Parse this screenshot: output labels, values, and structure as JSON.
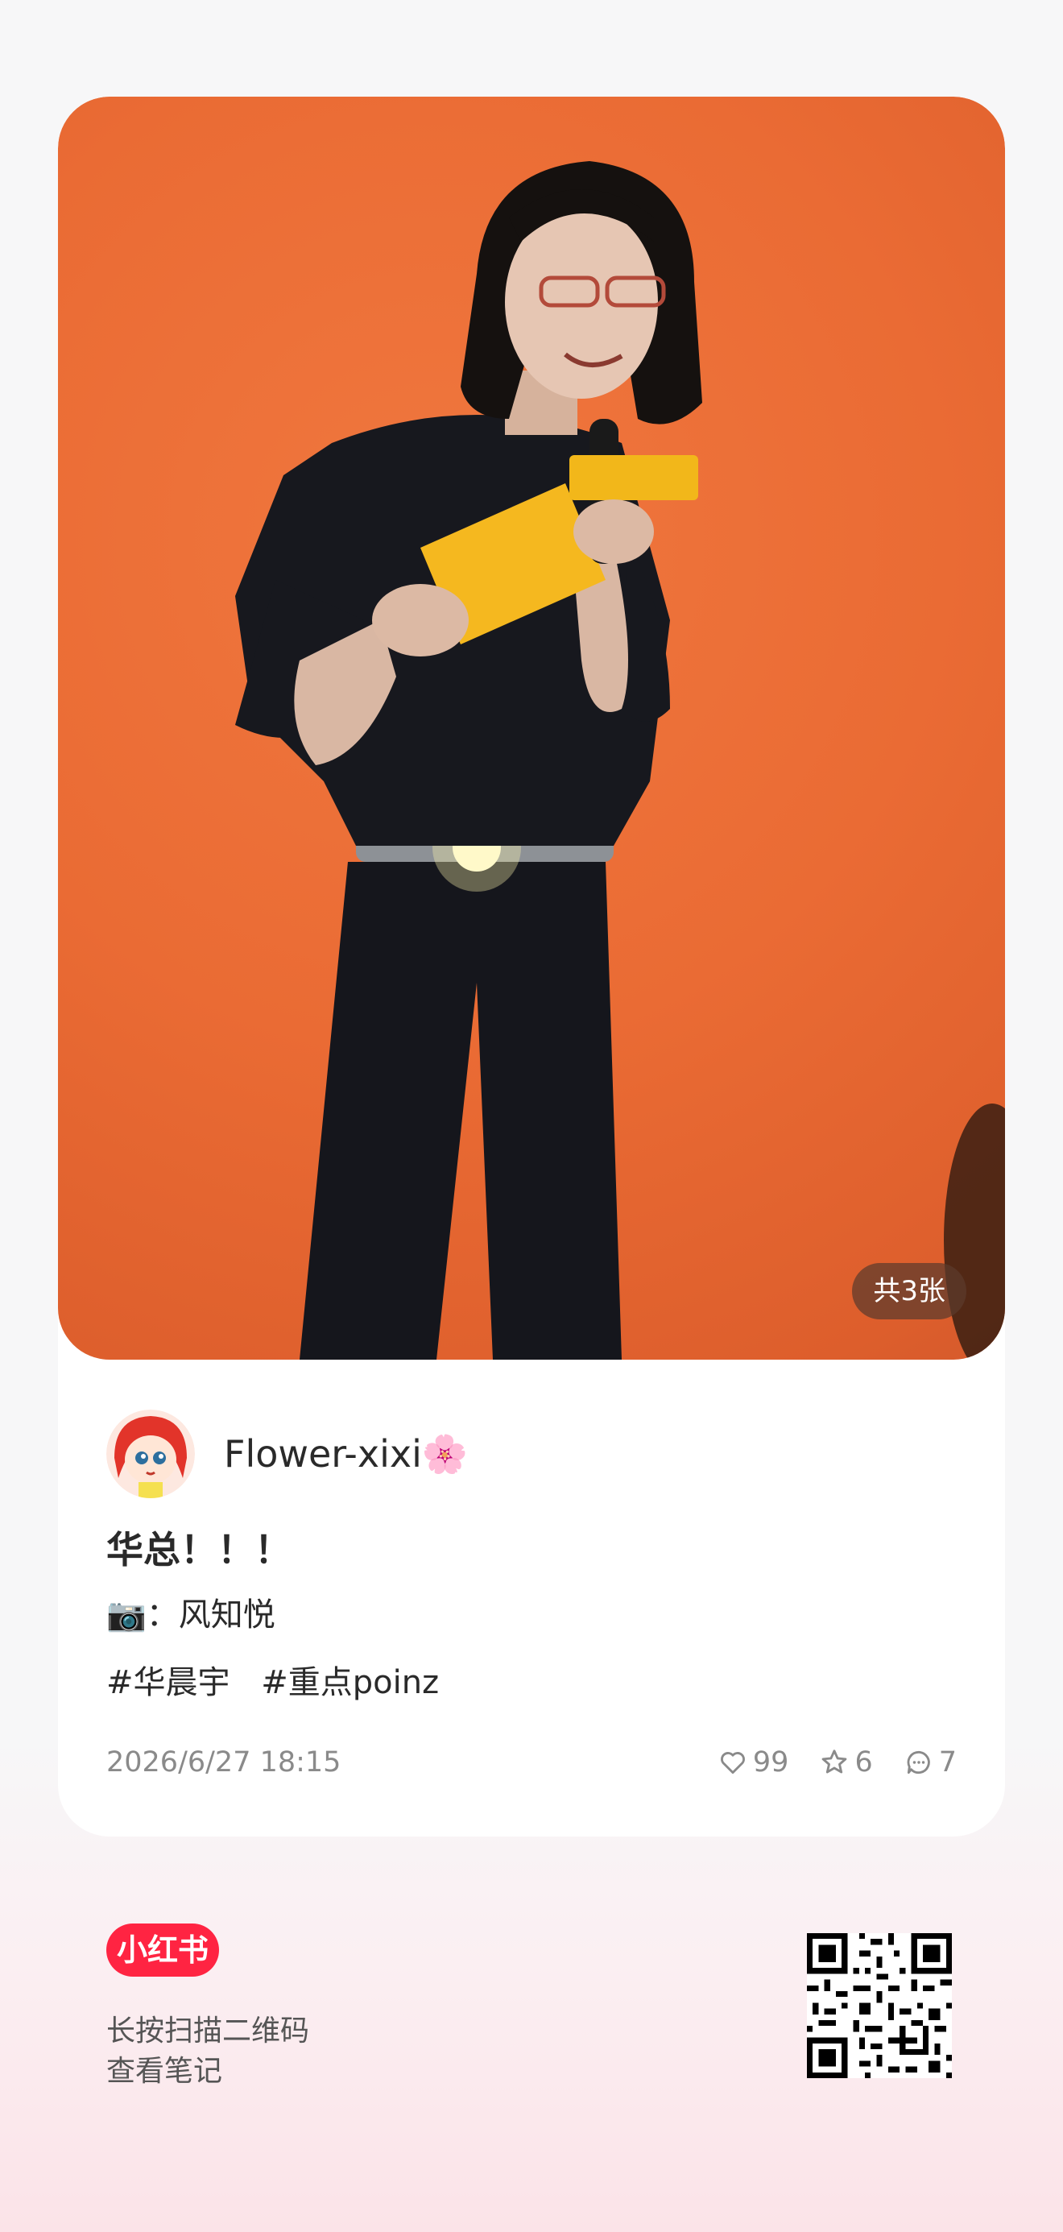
{
  "photo": {
    "count_badge": "共3张",
    "background_color": "#ea6b34"
  },
  "author": {
    "name": "Flower-xixi🌸"
  },
  "post": {
    "title": "华总！！！",
    "line1": "📷：风知悦",
    "tags": [
      "#华晨宇",
      "#重点poinz"
    ],
    "date": "2026/6/27 18:15"
  },
  "stats": {
    "likes": "99",
    "favorites": "6",
    "comments": "7"
  },
  "footer": {
    "brand": "小红书",
    "scan_line1": "长按扫描二维码",
    "scan_line2": "查看笔记"
  },
  "colors": {
    "brand_red": "#ff2442",
    "badge_bg": "#5c3a2c"
  },
  "icons": [
    "heart-icon",
    "star-icon",
    "comment-icon",
    "qr-code"
  ]
}
